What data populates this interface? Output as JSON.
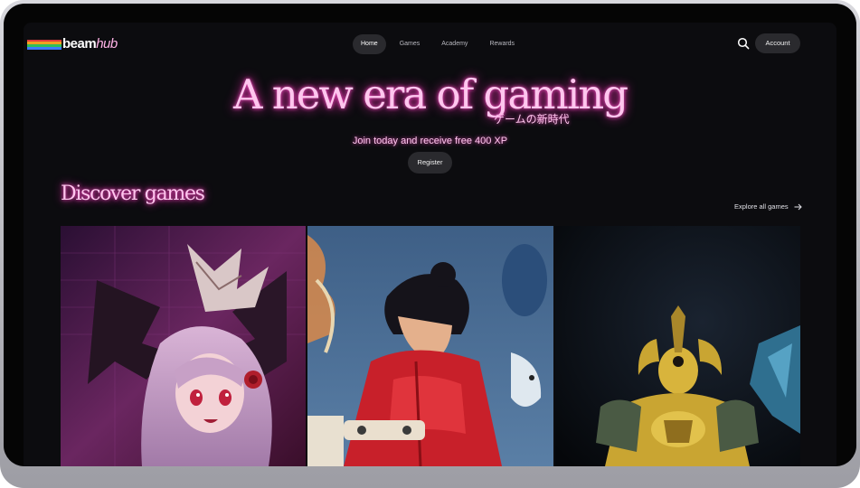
{
  "brand": {
    "name_left": "beam",
    "name_right": "hub",
    "stripe_colors": [
      "#e23a3a",
      "#f0a020",
      "#2fbf58",
      "#3a7bff"
    ]
  },
  "nav": {
    "items": [
      {
        "label": "Home",
        "active": true
      },
      {
        "label": "Games",
        "active": false
      },
      {
        "label": "Academy",
        "active": false
      },
      {
        "label": "Rewards",
        "active": false
      }
    ]
  },
  "header": {
    "search_icon": "search-icon",
    "account_label": "Account"
  },
  "hero": {
    "title": "A new era of gaming",
    "subtitle_jp": "ゲームの新時代",
    "tagline": "Join today and receive free 400 XP",
    "register_label": "Register"
  },
  "discover": {
    "heading": "Discover games",
    "explore_label": "Explore all games",
    "explore_icon": "arrow-right-icon"
  },
  "games": [
    {
      "art": "anime-demon-girl-artwork",
      "accent": "#e0509a"
    },
    {
      "art": "boy-in-red-jacket-artwork",
      "accent": "#d42a2a"
    },
    {
      "art": "golden-horned-warrior-artwork",
      "accent": "#c9a532"
    }
  ],
  "colors": {
    "accent_pink": "#ffc6ee",
    "glow_pink": "#ff4fc8",
    "background": "#0c0c0f",
    "pill": "#2a2a2e"
  }
}
